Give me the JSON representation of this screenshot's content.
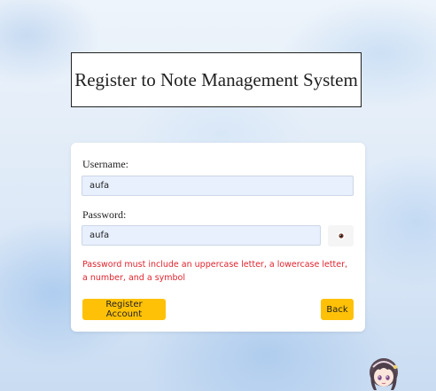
{
  "page": {
    "title": "Register to Note Management System"
  },
  "form": {
    "username_label": "Username:",
    "username_value": "aufa",
    "password_label": "Password:",
    "password_value": "aufa",
    "password_visibility_icon": "eye-icon",
    "error_message": "Password must include an uppercase letter, a lowercase letter, a number, and a symbol",
    "register_button_label": "Register Account",
    "back_button_label": "Back"
  },
  "colors": {
    "button_accent": "#ffc107",
    "error_text": "#e0242e",
    "input_background": "#e8f0fe"
  },
  "decorations": {
    "mascot_icon": "anime-girl-mascot"
  }
}
